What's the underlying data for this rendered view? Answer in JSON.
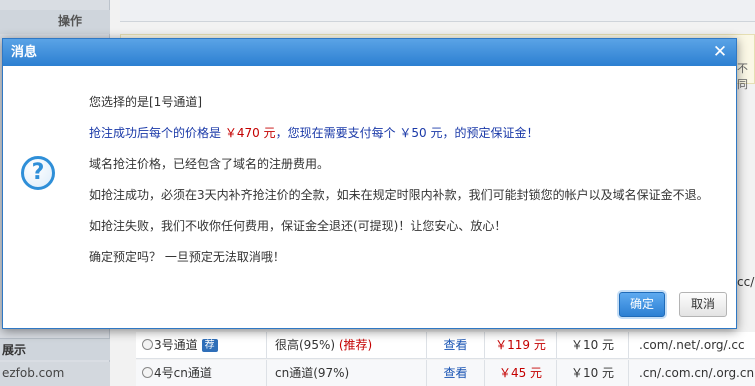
{
  "background": {
    "sidebar": {
      "op_label": "操作",
      "show_label": "展示",
      "site_label": "ezfob.com"
    },
    "edge_text_1": "不同",
    "edge_text_2": "cc/",
    "rows": [
      {
        "name": "3号通道",
        "tag": "荐",
        "rate": "很高(95%)",
        "recommend": "(推荐)",
        "view": "查看",
        "price": "￥119 元",
        "fee": "￥10 元",
        "suffix": ".com/.net/.org/.cc"
      },
      {
        "name": "4号cn通道",
        "tag": "",
        "rate": "cn通道(97%)",
        "recommend": "",
        "view": "查看",
        "price": "￥45 元",
        "fee": "￥10 元",
        "suffix": ".cn/.com.cn/.org.cn"
      }
    ]
  },
  "dialog": {
    "title": "消息",
    "close_glyph": "✕",
    "icon_glyph": "?",
    "line1": "您选择的是[1号通道]",
    "line2_pre": "抢注成功后每个的价格是 ",
    "line2_price": "￥470 元",
    "line2_post": "，您现在需要支付每个 ￥50 元，的预定保证金！",
    "line3": "域名抢注价格，已经包含了域名的注册费用。",
    "line4": "如抢注成功，必须在3天内补齐抢注价的全款，如未在规定时限内补款，我们可能封锁您的帐户以及域名保证金不退。",
    "line5": "如抢注失败，我们不收你任何费用，保证金全退还(可提现)！让您安心、放心！",
    "line6": "确定预定吗？ 一旦预定无法取消哦！",
    "ok_label": "确定",
    "cancel_label": "取消"
  },
  "colors": {
    "titlebar": "#2c7fd1",
    "price_red": "#c40000",
    "notice_blue": "#1a39a8"
  }
}
